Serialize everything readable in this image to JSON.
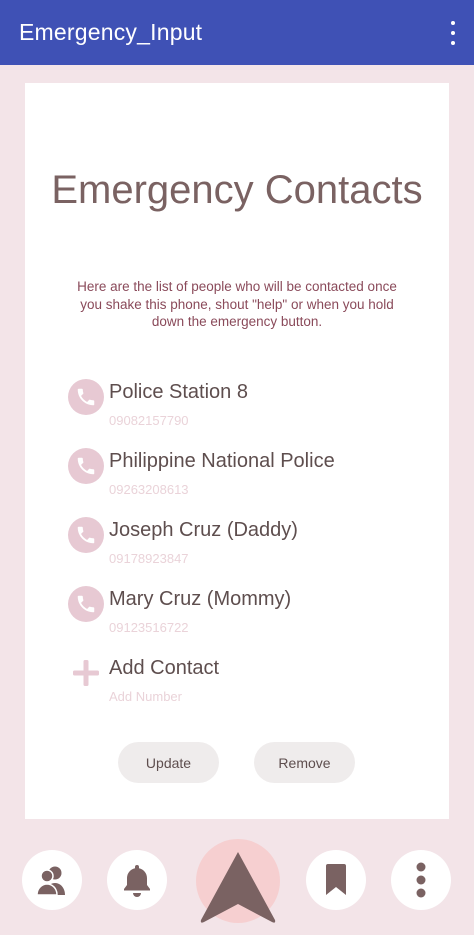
{
  "appbar": {
    "title": "Emergency_Input",
    "menu_icon": "more-vert-icon"
  },
  "main": {
    "heading": "Emergency Contacts",
    "description": "Here are the list of people who will be contacted once you shake this phone, shout \"help\" or when you hold down the emergency button.",
    "contacts": [
      {
        "name": "Police Station 8",
        "number": "09082157790",
        "icon": "phone-icon"
      },
      {
        "name": "Philippine National Police",
        "number": "09263208613",
        "icon": "phone-icon"
      },
      {
        "name": "Joseph Cruz (Daddy)",
        "number": "09178923847",
        "icon": "phone-icon"
      },
      {
        "name": "Mary Cruz (Mommy)",
        "number": "09123516722",
        "icon": "phone-icon"
      }
    ],
    "add_contact": {
      "name_placeholder": "Add Contact",
      "number_placeholder": "Add Number",
      "icon": "plus-icon"
    },
    "buttons": {
      "update": "Update",
      "remove": "Remove"
    }
  },
  "bottom_nav": {
    "items": [
      "contacts-icon",
      "bell-icon",
      "navigation-arrow-icon",
      "bookmark-icon",
      "more-vert-icon"
    ]
  },
  "colors": {
    "appbar": "#3f51b5",
    "background": "#f3e4e8",
    "icon_bg": "#e7c9d3",
    "heading": "#7a6262",
    "description": "#8a4a5a",
    "nav_icon": "#7a6262",
    "nav_center_bg": "#f6cfd0"
  }
}
